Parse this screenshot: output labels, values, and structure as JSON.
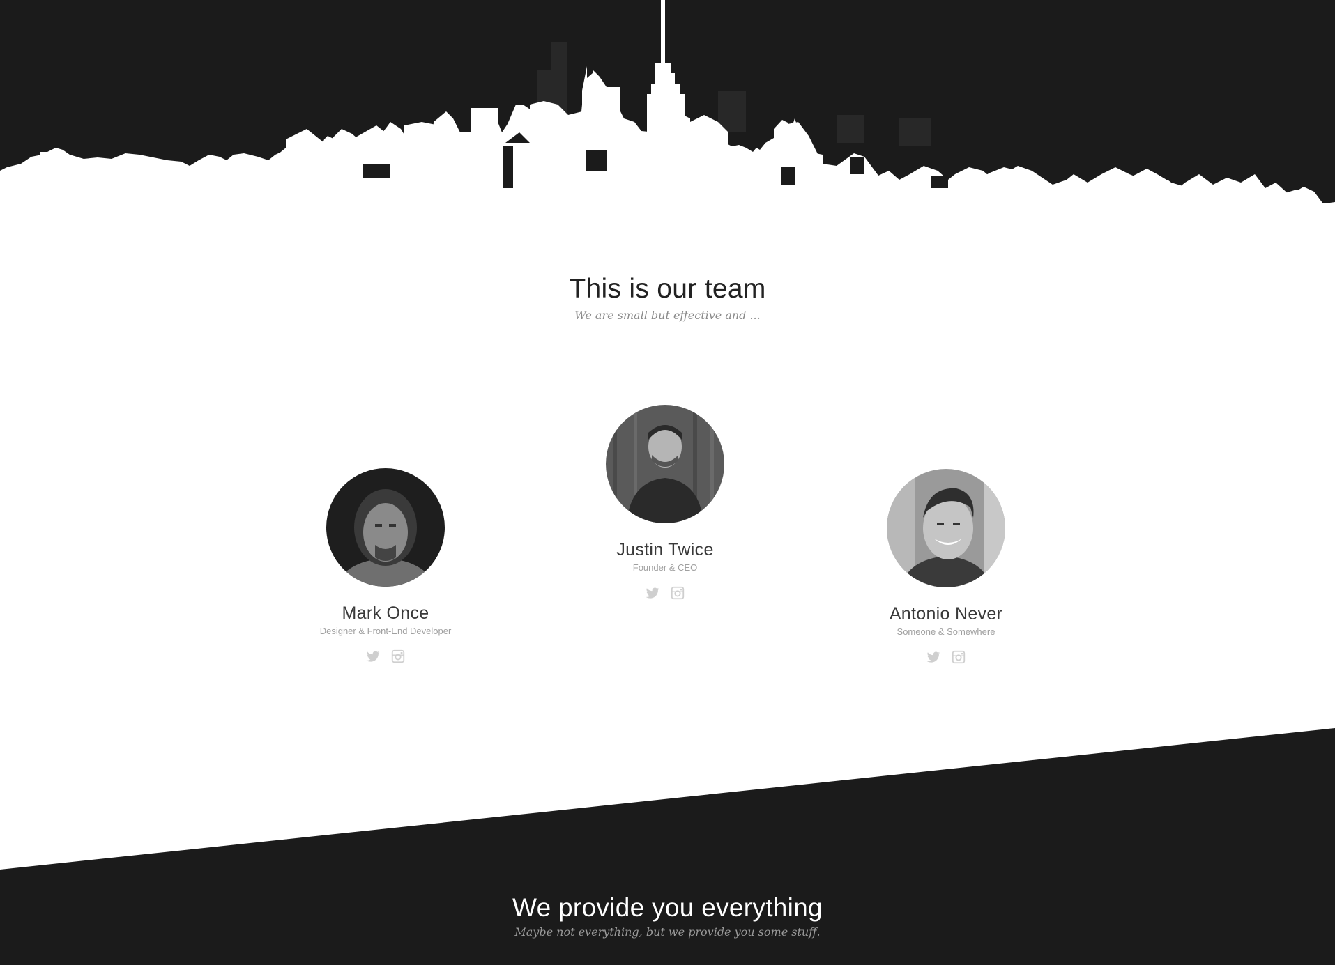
{
  "colors": {
    "dark": "#1b1b1b",
    "background": "#ffffff",
    "text_dark": "#222222",
    "text_muted": "#a0a0a0"
  },
  "team": {
    "title": "This is our team",
    "subtitle": "We are small but effective and ..."
  },
  "members": [
    {
      "name": "Mark Once",
      "role": "Designer & Front-End Developer",
      "socials": [
        "twitter-icon",
        "instagram-icon"
      ]
    },
    {
      "name": "Justin Twice",
      "role": "Founder & CEO",
      "socials": [
        "twitter-icon",
        "instagram-icon"
      ]
    },
    {
      "name": "Antonio Never",
      "role": "Someone & Somewhere",
      "socials": [
        "twitter-icon",
        "instagram-icon"
      ]
    }
  ],
  "provide": {
    "title": "We provide you everything",
    "subtitle": "Maybe not everything, but we provide you some stuff."
  }
}
